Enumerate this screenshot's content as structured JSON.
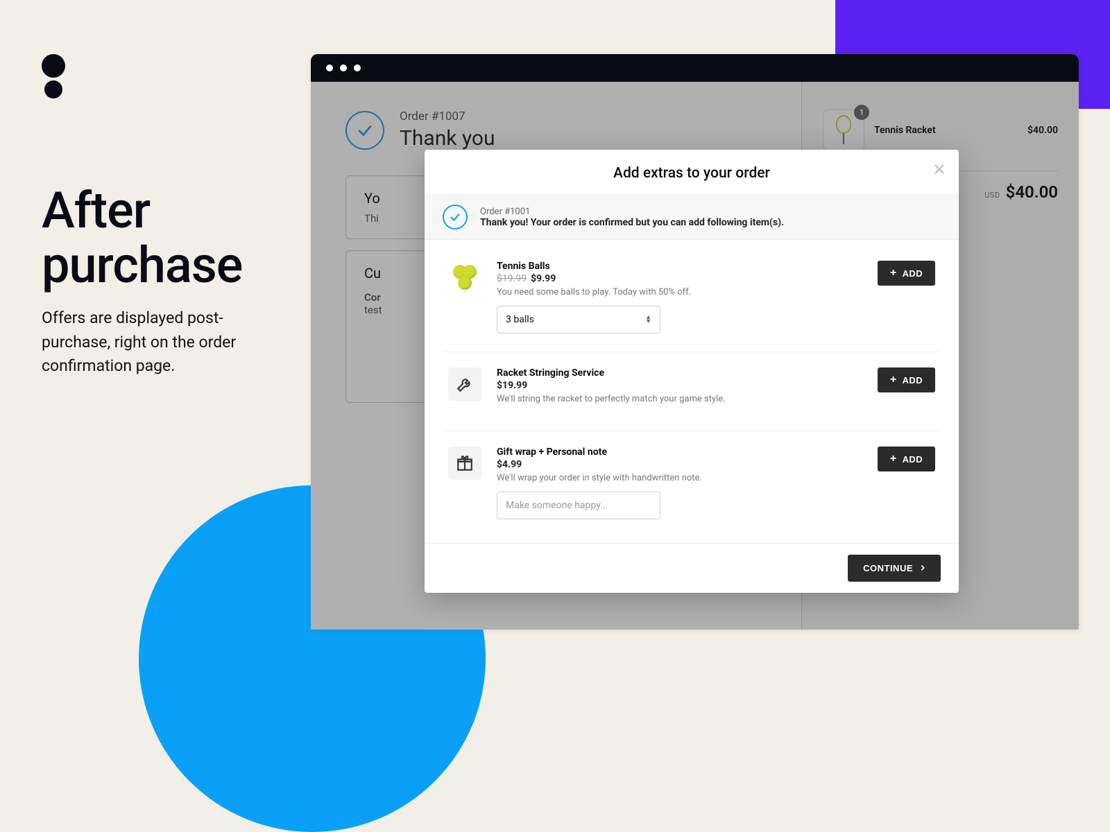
{
  "marketing": {
    "headline_line1": "After",
    "headline_line2": "purchase",
    "sub": "Offers are displayed post-purchase, right on the order confirmation page."
  },
  "order": {
    "number_label": "Order #1007",
    "thank_you": "Thank you",
    "panel1_title": "Yo",
    "panel1_body": "Thi",
    "panel2_title": "Cu",
    "panel2_label": "Cor",
    "panel2_value": "test"
  },
  "cart": {
    "item_qty": "1",
    "item_name": "Tennis Racket",
    "item_price": "$40.00",
    "currency": "USD",
    "total": "$40.00"
  },
  "modal": {
    "title": "Add extras to your order",
    "sub_order": "Order #1001",
    "sub_msg": "Thank you! Your order is confirmed but you can add following item(s).",
    "continue": "CONTINUE",
    "add_label": "ADD",
    "offers": [
      {
        "title": "Tennis Balls",
        "old_price": "$19.99",
        "price": "$9.99",
        "desc": "You need some balls to play. Today with 50% off.",
        "variant": "3 balls"
      },
      {
        "title": "Racket Stringing Service",
        "price": "$19.99",
        "desc": "We'll string the racket to perfectly match your game style."
      },
      {
        "title": "Gift wrap + Personal note",
        "price": "$4.99",
        "desc": "We'll wrap your order in style with handwritten note.",
        "placeholder": "Make someone happy..."
      }
    ]
  }
}
